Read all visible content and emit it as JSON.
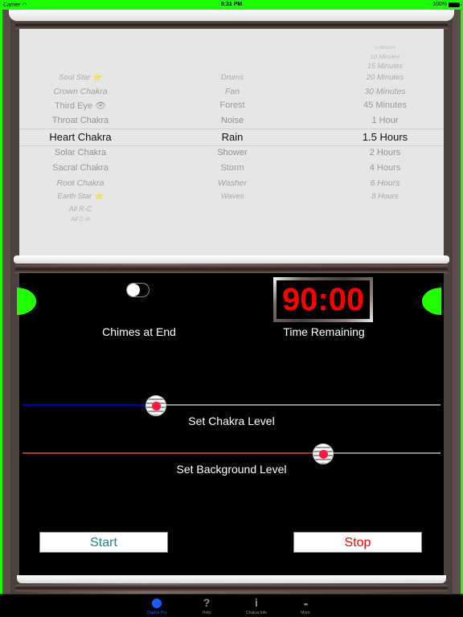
{
  "status_bar": {
    "carrier": "Carrier",
    "wifi_icon": "wifi-icon",
    "time": "9:31 PM",
    "battery_percent": "100%",
    "battery_icon": "battery-icon"
  },
  "pickers": {
    "chakra": {
      "items": [
        "Soul Star ⭐",
        "Crown Chakra",
        "Third Eye 👁",
        "Throat Chakra",
        "Heart Chakra",
        "Solar Chakra",
        "Sacral Chakra",
        "Root Chakra",
        "Earth Star ⭐",
        "All R-C",
        "All C-R"
      ],
      "selected": "Heart Chakra"
    },
    "background": {
      "items": [
        "Drums",
        "Fan",
        "Forest",
        "Noise",
        "Rain",
        "Shower",
        "Storm",
        "Washer",
        "Waves"
      ],
      "selected": "Rain"
    },
    "duration": {
      "items": [
        "5 Minutes",
        "10 Minutes",
        "15 Minutes",
        "20 Minutes",
        "30 Minutes",
        "45 Minutes",
        "1 Hour",
        "1.5 Hours",
        "2 Hours",
        "4 Hours",
        "6 Hours",
        "8 Hours"
      ],
      "selected": "1.5 Hours"
    }
  },
  "controls": {
    "chimes_toggle": {
      "label": "Chimes at End",
      "on": false
    },
    "timer": {
      "value": "90:00",
      "label": "Time Remaining"
    },
    "chakra_slider": {
      "label": "Set Chakra Level",
      "value": 0.32,
      "min_track_color": "#0000c8"
    },
    "background_slider": {
      "label": "Set Background Level",
      "value": 0.72,
      "min_track_color": "#a0400a"
    },
    "start_button": {
      "label": "Start",
      "color": "#1e8a8a"
    },
    "stop_button": {
      "label": "Stop",
      "color": "#ff0000"
    }
  },
  "tab_bar": {
    "tabs": [
      {
        "label": "Chakra Pro",
        "icon": "face-icon",
        "active": true
      },
      {
        "label": "Help",
        "icon": "?",
        "active": false
      },
      {
        "label": "Chakra Info",
        "icon": "i",
        "active": false
      },
      {
        "label": "More",
        "icon": "••",
        "active": false
      }
    ]
  },
  "colors": {
    "status_bar_bg": "#1aff00",
    "led_green": "#22ff00",
    "timer_red": "#ff0000",
    "tab_active": "#1a5cff"
  }
}
